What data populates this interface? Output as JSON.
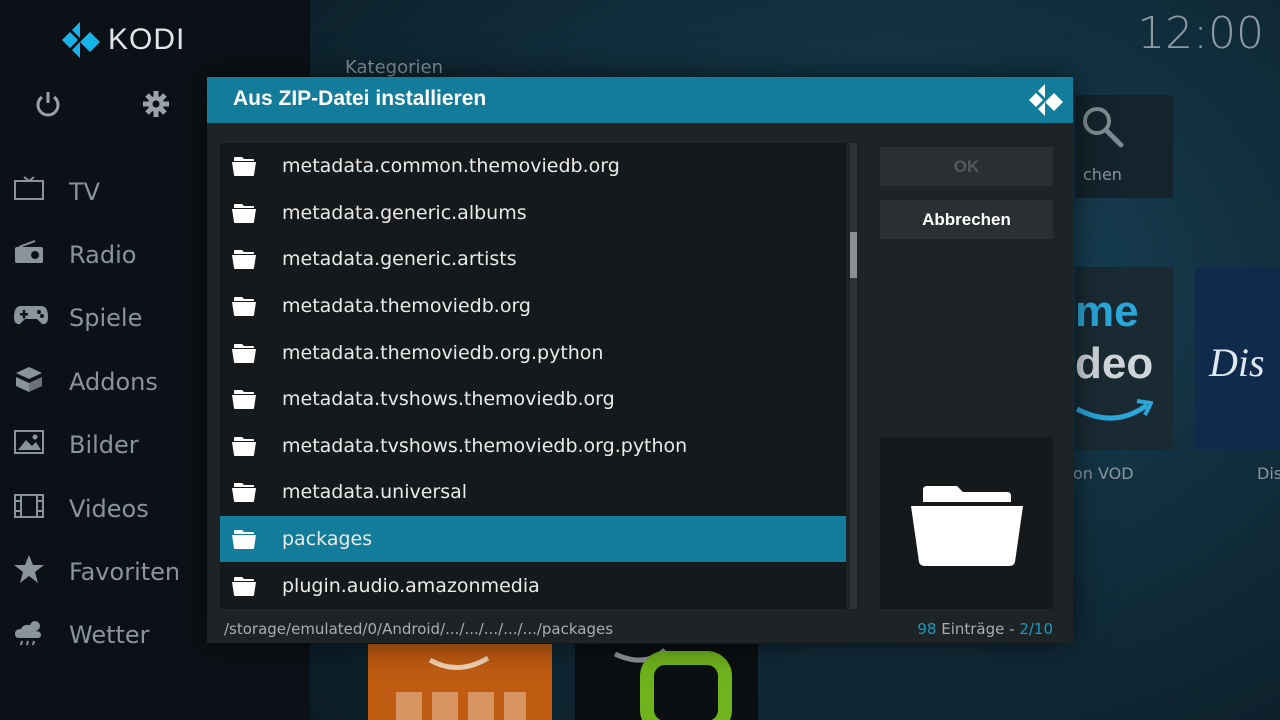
{
  "app": {
    "logo_text": "KODI",
    "clock": "12:00"
  },
  "sidebar": {
    "items": [
      {
        "label": "TV",
        "icon": "tv-icon"
      },
      {
        "label": "Radio",
        "icon": "radio-icon"
      },
      {
        "label": "Spiele",
        "icon": "gamepad-icon"
      },
      {
        "label": "Addons",
        "icon": "box-icon"
      },
      {
        "label": "Bilder",
        "icon": "picture-icon"
      },
      {
        "label": "Videos",
        "icon": "film-icon"
      },
      {
        "label": "Favoriten",
        "icon": "star-icon"
      },
      {
        "label": "Wetter",
        "icon": "weather-icon"
      }
    ]
  },
  "background": {
    "category_label": "Kategorien",
    "tile_search": "chen",
    "tile_prime_top": "me",
    "tile_prime_bottom": "deo",
    "tile_prime_label": "on VOD",
    "tile_disney": "Dis",
    "tile_disney_label": "Dis"
  },
  "dialog": {
    "title": "Aus ZIP-Datei installieren",
    "items": [
      "metadata.common.themoviedb.org",
      "metadata.generic.albums",
      "metadata.generic.artists",
      "metadata.themoviedb.org",
      "metadata.themoviedb.org.python",
      "metadata.tvshows.themoviedb.org",
      "metadata.tvshows.themoviedb.org.python",
      "metadata.universal",
      "packages",
      "plugin.audio.amazonmedia"
    ],
    "selected_index": 8,
    "ok_label": "OK",
    "cancel_label": "Abbrechen",
    "path": "/storage/emulated/0/Android/.../.../.../.../.../packages",
    "count_number": "98",
    "count_text": " Einträge - ",
    "count_page": "2/10"
  },
  "colors": {
    "accent": "#137c9a",
    "highlight_text": "#1c9ac0"
  }
}
